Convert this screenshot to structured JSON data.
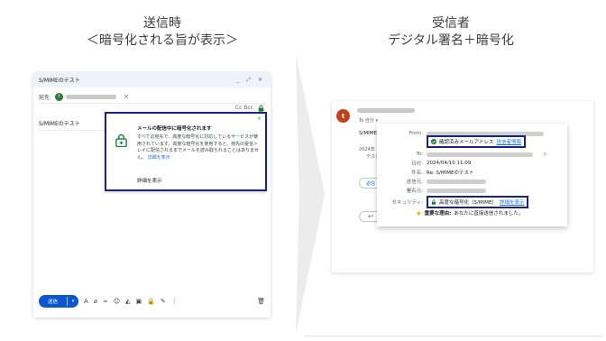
{
  "headings": {
    "left": {
      "line1": "送信時",
      "line2": "＜暗号化される旨が表示＞"
    },
    "right": {
      "line1": "受信者",
      "line2": "デジタル署名＋暗号化"
    }
  },
  "compose": {
    "window_title": "S/MIMEのテスト",
    "window_controls": "_ ⤢ ✕",
    "to_label": "宛先",
    "recipient_initial": "t",
    "remove_chip": "×",
    "cc_bcc": "Cc Bcc",
    "subject": "S/MIMEのテスト",
    "popup": {
      "close": "×",
      "title": "メールの配信中に暗号化されます",
      "body": "すべての宛先で、高度な暗号化に対応しているサービスが使用されています。高度な暗号化を使用すると、宛先の受信トレイに配信されるまでメールを読み取られることはありません。",
      "link": "詳細を表示",
      "detail_button": "詳細を表示"
    },
    "send_label": "送信",
    "send_dropdown": "▾",
    "toolbar_icons": [
      "A",
      "⌀",
      "∞",
      "☺",
      "◭",
      "▣",
      "🔒",
      "✎",
      "⋮"
    ],
    "trash": "🗑"
  },
  "received": {
    "avatar_initial": "t",
    "to_me": "To 自分 ▾",
    "subject": "S/MIME",
    "date_line": "2024年",
    "text_line": "テスト",
    "reply_label": "返信",
    "forward_icon": "↩",
    "details": {
      "from_label": "From:",
      "verified_text": "確認済みメールアドレス",
      "verified_link": "送信者情報",
      "to_label": "To:",
      "date_label": "日付:",
      "date_value": "2024/04/10 11:09",
      "subject_label": "件名:",
      "subject_value": "Re: S/MIMEのテスト",
      "mailed_by_label": "送信元:",
      "signed_by_label": "署名元:",
      "security_label": "セキュリティ:",
      "security_text": "高度な暗号化（S/MIME）",
      "security_link": "詳細を表示",
      "importance_bold": "重要な理由:",
      "importance_text": "あなたに直接送信されました。"
    }
  },
  "colors": {
    "highlight_border": "#1a237e",
    "send_button": "#0b57d0",
    "link": "#1a73e8",
    "avatar_received": "#c5401a",
    "avatar_compose": "#2e7d32",
    "verified_green": "#188038"
  }
}
